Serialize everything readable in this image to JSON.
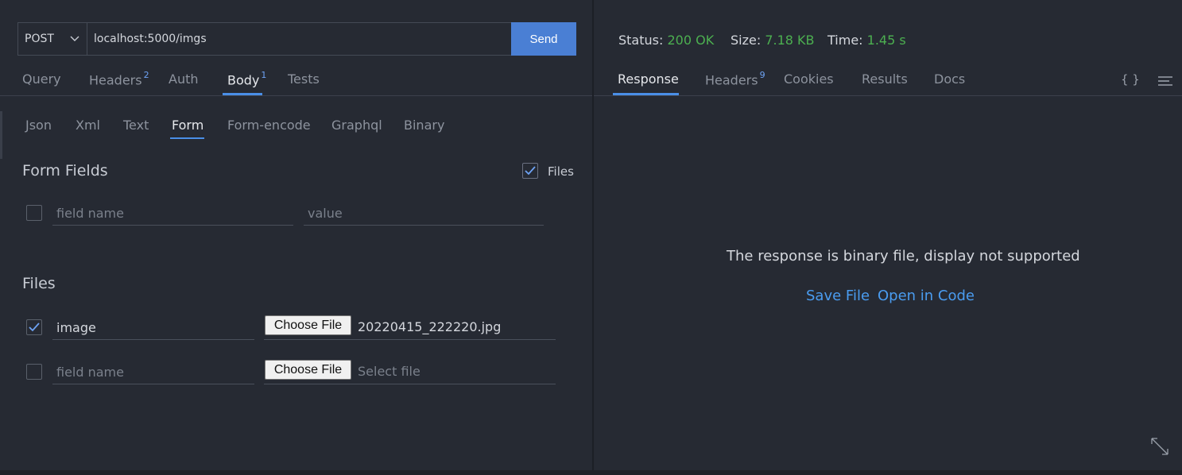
{
  "request": {
    "method": "POST",
    "url": "localhost:5000/imgs",
    "send_label": "Send",
    "tabs": [
      {
        "label": "Query",
        "badge": ""
      },
      {
        "label": "Headers",
        "badge": "2"
      },
      {
        "label": "Auth",
        "badge": ""
      },
      {
        "label": "Body",
        "badge": "1"
      },
      {
        "label": "Tests",
        "badge": ""
      }
    ],
    "active_tab": "Body",
    "body_types": [
      "Json",
      "Xml",
      "Text",
      "Form",
      "Form-encode",
      "Graphql",
      "Binary"
    ],
    "active_body_type": "Form",
    "form": {
      "title": "Form Fields",
      "files_toggle_label": "Files",
      "files_toggle_checked": true,
      "field_name_placeholder": "field name",
      "value_placeholder": "value"
    },
    "files": {
      "title": "Files",
      "rows": [
        {
          "checked": true,
          "name": "image",
          "button": "Choose File",
          "file": "20220415_222220.jpg"
        },
        {
          "checked": false,
          "name": "",
          "name_placeholder": "field name",
          "button": "Choose File",
          "file": "",
          "file_placeholder": "Select file"
        }
      ]
    }
  },
  "response": {
    "status_label": "Status:",
    "status_value": "200 OK",
    "size_label": "Size:",
    "size_value": "7.18 KB",
    "time_label": "Time:",
    "time_value": "1.45 s",
    "tabs": [
      {
        "label": "Response",
        "badge": ""
      },
      {
        "label": "Headers",
        "badge": "9"
      },
      {
        "label": "Cookies",
        "badge": ""
      },
      {
        "label": "Results",
        "badge": ""
      },
      {
        "label": "Docs",
        "badge": ""
      }
    ],
    "active_tab": "Response",
    "braces_icon": "{ }",
    "message": "The response is binary file, display not supported",
    "save_file": "Save File",
    "open_in_code": "Open in Code"
  },
  "colors": {
    "background": "#262a33",
    "accent": "#4a7fd4",
    "status_ok": "#4caf50",
    "link": "#4a9cf0"
  },
  "icons": [
    "chevron-down-icon",
    "checkmark-icon",
    "braces-icon",
    "menu-lines-icon",
    "expand-icon"
  ]
}
